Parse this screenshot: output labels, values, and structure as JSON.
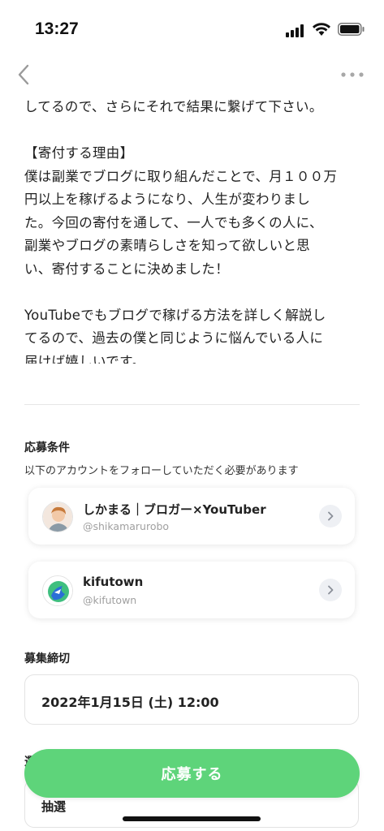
{
  "status_bar": {
    "time": "13:27"
  },
  "article": {
    "lines": [
      "してるので、さらにそれで結果に繋げて下さい。",
      "",
      "【寄付する理由】",
      "僕は副業でブログに取り組んだことで、月１００万",
      "円以上を稼げるようになり、人生が変わりまし",
      "た。今回の寄付を通して、一人でも多くの人に、",
      "副業やブログの素晴らしさを知って欲しいと思",
      "い、寄付することに決めました！",
      "",
      "YouTubeでもブログで稼げる方法を詳しく解説し",
      "てるので、過去の僕と同じように悩んでいる人に",
      "届けば嬉しいです。"
    ]
  },
  "requirements": {
    "title": "応募条件",
    "description": "以下のアカウントをフォローしていただく必要があります",
    "accounts": [
      {
        "name": "しかまる｜ブロガー×YouTuber",
        "handle": "@shikamarurobo"
      },
      {
        "name": "kifutown",
        "handle": "@kifutown"
      }
    ]
  },
  "deadline": {
    "title": "募集締切",
    "value": "2022年1月15日 (土) 12:00"
  },
  "selection": {
    "title": "選",
    "value": "抽選"
  },
  "apply_button": {
    "label": "応募する"
  },
  "colors": {
    "accent": "#5ed47a",
    "text": "#222222",
    "muted": "#a0a0a0"
  }
}
